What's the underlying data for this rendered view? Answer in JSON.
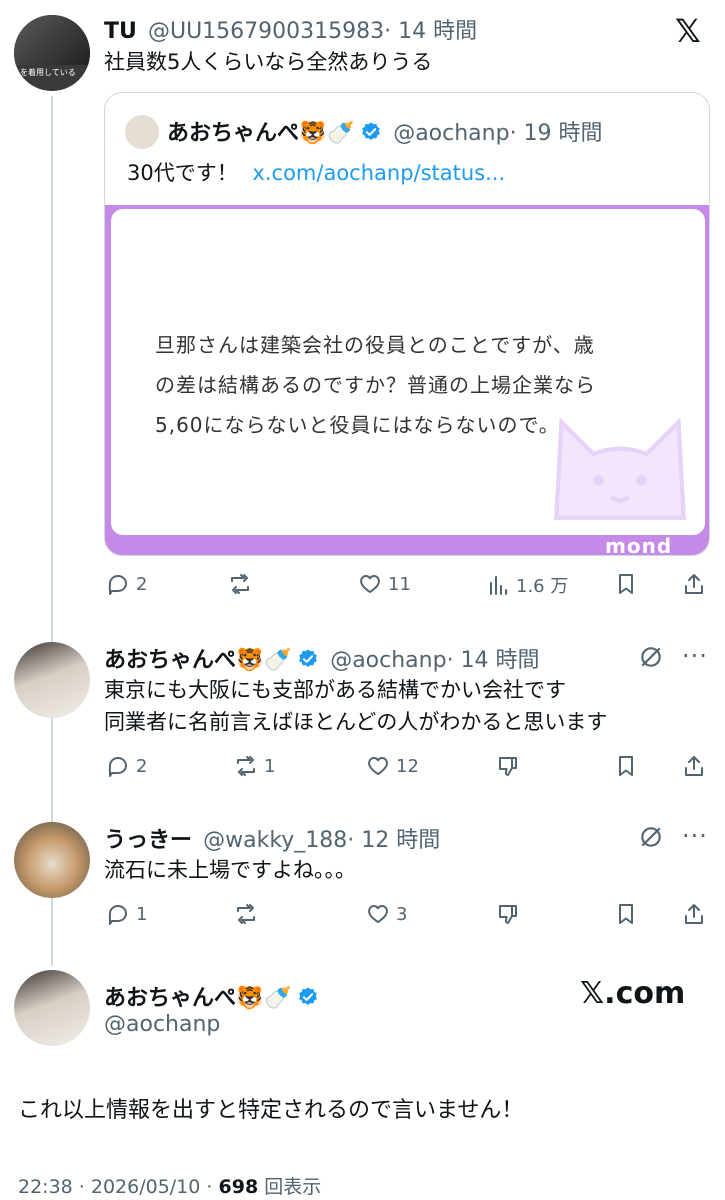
{
  "header_tweet": {
    "name": "TU",
    "handle": "@UU1567900315983",
    "time": "· 14 時間",
    "text": "社員数5人くらいなら全然ありうる",
    "avatar_overlay": "を着用している",
    "x_logo": "𝕏"
  },
  "quote": {
    "name": "あおちゃんぺ",
    "emoji1": "🐯",
    "emoji2": "🍼",
    "handle": "@aochanp",
    "time": "· 19 時間",
    "text": "30代です！",
    "link": "x.com/aochanp/status...",
    "mond_text_line1": "旦那さんは建築会社の役員とのことですが、歳",
    "mond_text_line2": "の差は結構あるのですか？普通の上場企業なら",
    "mond_text_line3": "5,60にならないと役員にはならないので。",
    "mond_brand": "mond"
  },
  "header_actions": {
    "reply_count": "2",
    "retweet_count": "",
    "like_count": "11",
    "view_count": "1.6 万"
  },
  "reply1": {
    "name": "あおちゃんぺ",
    "emoji1": "🐯",
    "emoji2": "🍼",
    "handle": "@aochanp",
    "time": "· 14 時間",
    "line1": "東京にも大阪にも支部がある結構でかい会社です",
    "line2": "同業者に名前言えばほとんどの人がわかると思います",
    "reply_count": "2",
    "retweet_count": "1",
    "like_count": "12"
  },
  "reply2": {
    "name": "うっきー",
    "handle": "@wakky_188",
    "time": "· 12 時間",
    "text": "流石に未上場ですよね。。。",
    "reply_count": "1",
    "retweet_count": "",
    "like_count": "3"
  },
  "main_tweet": {
    "name": "あおちゃんぺ",
    "emoji1": "🐯",
    "emoji2": "🍼",
    "handle": "@aochanp",
    "text": "これ以上情報を出すと特定されるので言いません！",
    "watermark": "𝕏.com",
    "timestamp": "22:38 · 2026/05/10 · ",
    "views_number": "698",
    "views_label": " 回表示"
  },
  "colors": {
    "accent": "#1d9bf0",
    "text": "#0f1419",
    "muted": "#536471",
    "mond_purple": "#c58ae8"
  }
}
